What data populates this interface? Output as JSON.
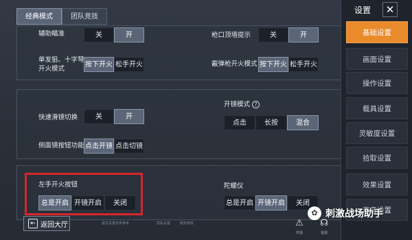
{
  "tabs": [
    {
      "label": "经典模式",
      "active": true
    },
    {
      "label": "团队竞技",
      "active": false
    }
  ],
  "sections": {
    "s1": {
      "aim_assist": {
        "label": "辅助瞄准",
        "options": [
          "关",
          "开"
        ],
        "selected": "开"
      },
      "muzzle_hint": {
        "label": "枪口顶墙提示",
        "options": [
          "关",
          "开"
        ],
        "selected": "开"
      },
      "single_fire": {
        "label_line1": "单发狙、十字弩",
        "label_line2": "开火模式",
        "options": [
          "按下开火",
          "松手开火"
        ],
        "selected": "按下开火"
      },
      "shotgun_fire": {
        "label": "霰弹枪开火模式",
        "options": [
          "按下开火",
          "松手开火"
        ],
        "selected": "按下开火"
      }
    },
    "s2": {
      "quick_scope": {
        "label": "快速滑镜切换",
        "options": [
          "关",
          "开"
        ],
        "selected": "开"
      },
      "scope_mode": {
        "label": "开镜模式",
        "options": [
          "点击",
          "长按",
          "混合"
        ],
        "selected": "混合"
      },
      "side_scope": {
        "label": "侧面镜按钮功能",
        "options": [
          "点击开镜",
          "点击切镜"
        ],
        "selected": "点击开镜"
      }
    },
    "s3": {
      "left_fire": {
        "label": "左手开火按钮",
        "options": [
          "总是开启",
          "开镜开启",
          "关闭"
        ],
        "selected": "总是开启"
      },
      "gyro": {
        "label": "陀螺仪",
        "options": [
          "总是开启",
          "开镜开启",
          "关闭"
        ],
        "selected": "开镜开启"
      }
    }
  },
  "sidebar": {
    "title": "设置",
    "close": "✕",
    "items": [
      {
        "label": "基础设置",
        "active": true
      },
      {
        "label": "画面设置",
        "active": false
      },
      {
        "label": "操作设置",
        "active": false
      },
      {
        "label": "载具设置",
        "active": false
      },
      {
        "label": "灵敏度设置",
        "active": false
      },
      {
        "label": "拾取设置",
        "active": false
      },
      {
        "label": "效果设置",
        "active": false
      },
      {
        "label": "声音设置",
        "active": false
      }
    ]
  },
  "footer": {
    "back": "返回大厅",
    "faint": [
      "最优设置仅供参考",
      "隐私设置",
      "服务条款"
    ],
    "report": "举报",
    "feedback": "客服"
  },
  "watermark": {
    "text": "刺激战场助手"
  },
  "colors": {
    "accent": "#e98a2b",
    "highlight_box": "#d8252b"
  }
}
